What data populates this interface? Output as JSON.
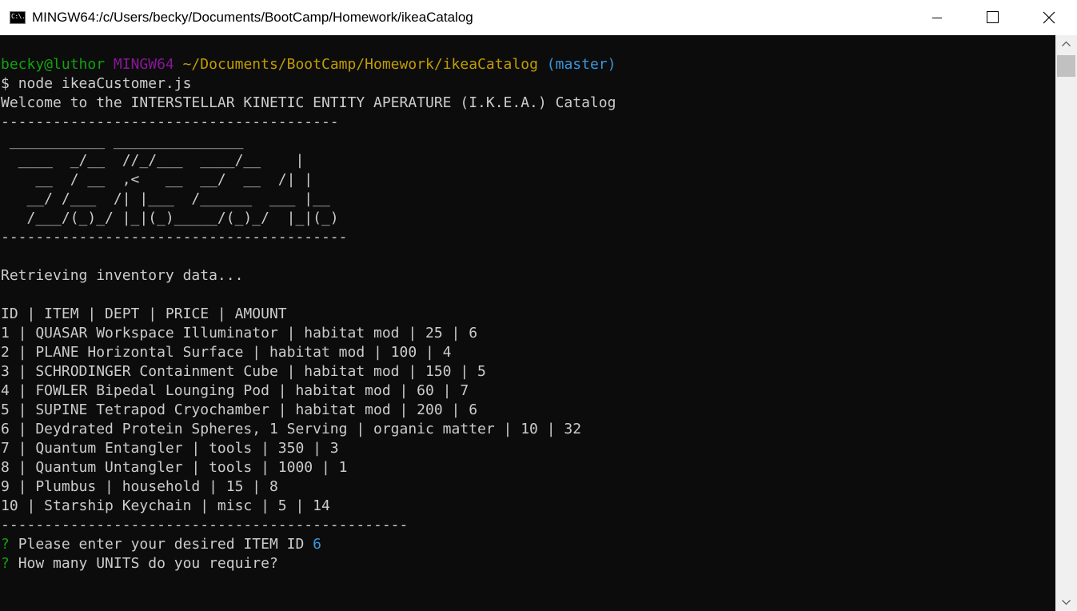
{
  "window": {
    "title": "MINGW64:/c/Users/becky/Documents/BootCamp/Homework/ikeaCatalog",
    "icon": "terminal-icon",
    "icon_text": "C:\\."
  },
  "terminal": {
    "prompt": {
      "user_host": "becky@luthor",
      "env": "MINGW64",
      "path": "~/Documents/BootCamp/Homework/ikeaCatalog",
      "branch": "(master)",
      "dollar": "$",
      "command": "node ikeaCustomer.js"
    },
    "welcome": "Welcome to the INTERSTELLAR KINETIC ENTITY APERATURE (I.K.E.A.) Catalog",
    "separator_top": "---------------------------------------",
    "ascii_art": [
      " ___________ _______________  ",
      "  ____  _/__  //_/___  ____/__    |",
      "    __  / __  ,<   __  __/  __  /| |",
      "   __/ /___  /| |___  /______  ___ |__",
      "   /___/(_)_/ |_|(_)_____/(_)_/  |_|(_)"
    ],
    "separator_art": "----------------------------------------",
    "status": "Retrieving inventory data...",
    "table_header": "ID | ITEM | DEPT | PRICE | AMOUNT",
    "rows": [
      "1 | QUASAR Workspace Illuminator | habitat mod | 25 | 6",
      "2 | PLANE Horizontal Surface | habitat mod | 100 | 4",
      "3 | SCHRODINGER Containment Cube | habitat mod | 150 | 5",
      "4 | FOWLER Bipedal Lounging Pod | habitat mod | 60 | 7",
      "5 | SUPINE Tetrapod Cryochamber | habitat mod | 200 | 6",
      "6 | Deydrated Protein Spheres, 1 Serving | organic matter | 10 | 32",
      "7 | Quantum Entangler | tools | 350 | 3",
      "8 | Quantum Untangler | tools | 1000 | 1",
      "9 | Plumbus | household | 15 | 8",
      "10 | Starship Keychain | misc | 5 | 14"
    ],
    "separator_bottom": "-----------------------------------------------",
    "question1": {
      "marker": "?",
      "text": "Please enter your desired ITEM ID",
      "answer": "6"
    },
    "question2": {
      "marker": "?",
      "text": "How many UNITS do you require?"
    }
  },
  "colors": {
    "background": "#0c0c0c",
    "foreground": "#cccccc",
    "green": "#13a10e",
    "magenta": "#881798",
    "yellow": "#c19c00",
    "cyan": "#3a96dd"
  }
}
